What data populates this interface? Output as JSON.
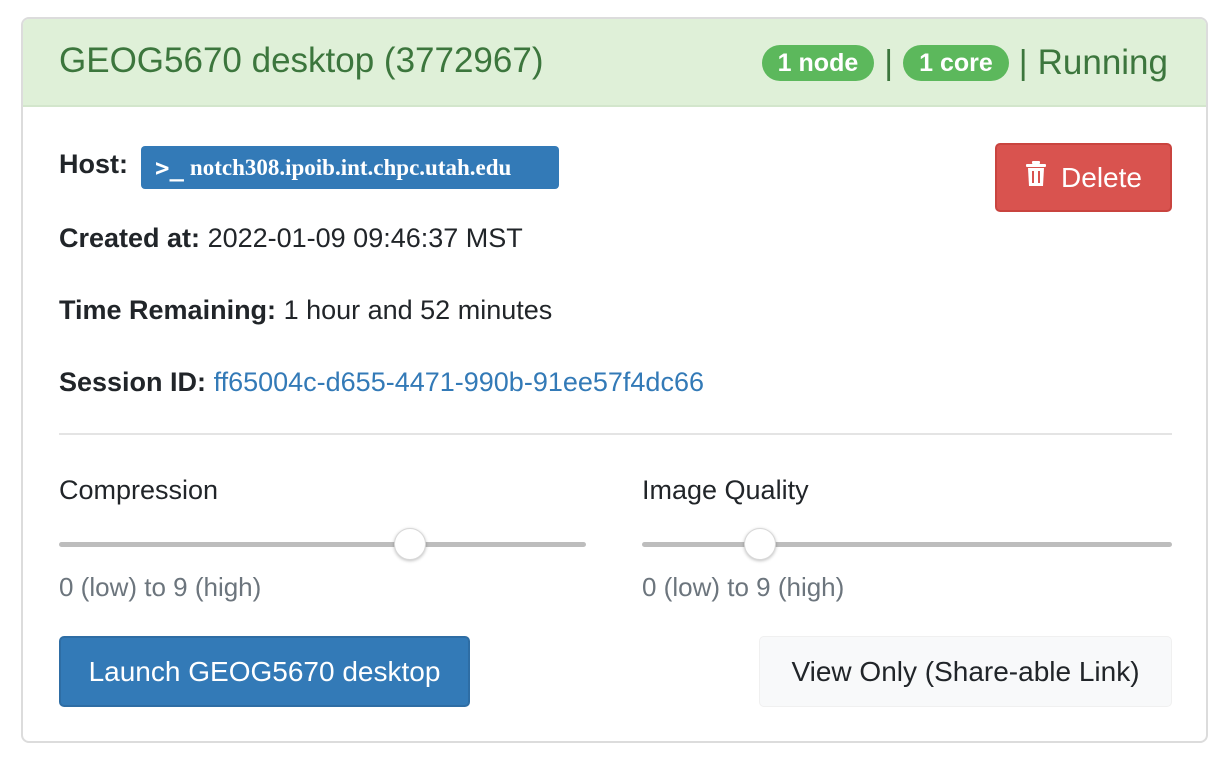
{
  "session": {
    "title": "GEOG5670 desktop (3772967)",
    "nodes_badge": "1 node",
    "separator": "|",
    "cores_badge": "1 core",
    "status": "Running",
    "host_label": "Host:",
    "host_prompt": ">_",
    "host_value": "notch308.ipoib.int.chpc.utah.edu",
    "created_label": "Created at:",
    "created_value": "2022-01-09 09:46:37 MST",
    "remaining_label": "Time Remaining:",
    "remaining_value": "1 hour and 52 minutes",
    "session_id_label": "Session ID:",
    "session_id_value": "ff65004c-d655-4471-990b-91ee57f4dc66",
    "delete_label": "Delete"
  },
  "sliders": {
    "compression": {
      "label": "Compression",
      "help": "0 (low) to 9 (high)",
      "value": 6,
      "max": 9
    },
    "quality": {
      "label": "Image Quality",
      "help": "0 (low) to 9 (high)",
      "value": 2,
      "max": 9
    }
  },
  "actions": {
    "launch_label": "Launch GEOG5670 desktop",
    "view_only_label": "View Only (Share-able Link)"
  },
  "colors": {
    "header_bg": "#dff0d8",
    "header_text": "#3c763d",
    "badge_green": "#5cb85c",
    "primary_blue": "#337ab7",
    "danger_red": "#d9534f"
  },
  "icons": {
    "delete": "trash-icon",
    "host": "terminal-prompt-icon"
  }
}
